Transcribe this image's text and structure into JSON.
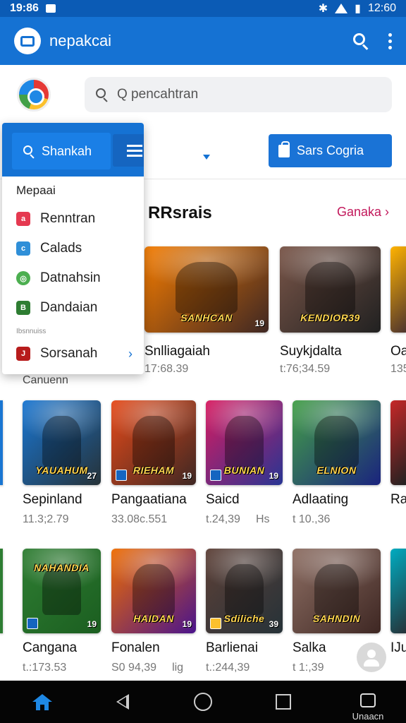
{
  "status_bar": {
    "time": "19:86",
    "right_text": "12:60"
  },
  "app_bar": {
    "title": "nepakcai"
  },
  "search": {
    "placeholder": "Q pencahtran"
  },
  "toolbar": {
    "primary_button_label": "Sars Cogria"
  },
  "section": {
    "title": "RRsrais",
    "more_link": "Ganaka"
  },
  "dropdown": {
    "search_label": "Shankah",
    "heading": "Mepaai",
    "items": [
      {
        "label": "Renntran",
        "icon": "app-icon-red",
        "color": "#e53950"
      },
      {
        "label": "Calads",
        "icon": "app-icon-blue",
        "color": "#2f8fd8"
      },
      {
        "label": "Datnahsin",
        "icon": "app-icon-green",
        "color": "#4caf50"
      },
      {
        "label": "Dandaian",
        "icon": "app-icon-darkgreen",
        "color": "#2e7d32"
      }
    ],
    "subheading": "Ibsnnuiss",
    "footer_item": {
      "label": "Sorsanah",
      "color": "#b71c1c"
    }
  },
  "under_menu_text": "Canuenn",
  "games_row1": [
    {
      "title": "SANHCAN",
      "name": "Snlliagaiah",
      "meta": "17:68.39",
      "badge": "19",
      "colors": [
        "#f57c00",
        "#3e2723"
      ]
    },
    {
      "title": "KENDIOR39",
      "name": "Suykjdalta",
      "meta": "t:76;34.59",
      "badge": "",
      "colors": [
        "#795548",
        "#212121"
      ]
    },
    {
      "title": "",
      "name": "Oa",
      "meta": "135",
      "badge": "",
      "colors": [
        "#ffb300",
        "#4e342e"
      ]
    }
  ],
  "games_row2": [
    {
      "title": "YAUAHUM",
      "name": "Sepinland",
      "meta": "11.3;2.79",
      "dl": "",
      "badge": "27",
      "colors": [
        "#1976d2",
        "#263238"
      ]
    },
    {
      "title": "RIEHAM",
      "name": "Pangaatiana",
      "meta": "33.08c.551",
      "dl": "",
      "badge": "19",
      "colors": [
        "#e64a19",
        "#3e2723"
      ]
    },
    {
      "title": "BUNIAN",
      "name": "Saicd",
      "meta": "t.24,39",
      "dl": "Hs",
      "badge": "19",
      "colors": [
        "#d81b60",
        "#283593"
      ]
    },
    {
      "title": "ELNION",
      "name": "Adlaating",
      "meta": "t 10.,36",
      "dl": "",
      "badge": "",
      "colors": [
        "#43a047",
        "#1a237e"
      ]
    },
    {
      "title": "",
      "name": "Ra",
      "meta": "",
      "dl": "",
      "badge": "",
      "colors": [
        "#c62828",
        "#212121"
      ]
    }
  ],
  "games_row3": [
    {
      "title": "NAHANDIA",
      "name": "Cangana",
      "meta": "t.:173.53",
      "dl": "",
      "badge": "19",
      "colors": [
        "#2e7d32",
        "#1b5e20"
      ]
    },
    {
      "title": "HAIDAN",
      "name": "Fonalen",
      "meta": "S0 94,39",
      "dl": "lig",
      "badge": "19",
      "colors": [
        "#ef6c00",
        "#4a148c"
      ]
    },
    {
      "title": "Sdiliche",
      "name": "Barlienai",
      "meta": "t.:244,39",
      "dl": "",
      "badge": "39",
      "colors": [
        "#5d4037",
        "#263238"
      ]
    },
    {
      "title": "SAHNDIN",
      "name": "Salka",
      "meta": "t 1:,39",
      "dl": "",
      "badge": "",
      "colors": [
        "#8d6e63",
        "#3e2723"
      ]
    },
    {
      "title": "",
      "name": "IJu",
      "meta": "",
      "dl": "",
      "badge": "",
      "colors": [
        "#00acc1",
        "#263238"
      ]
    }
  ],
  "bottom_nav": {
    "last_label": "Unaacn"
  }
}
